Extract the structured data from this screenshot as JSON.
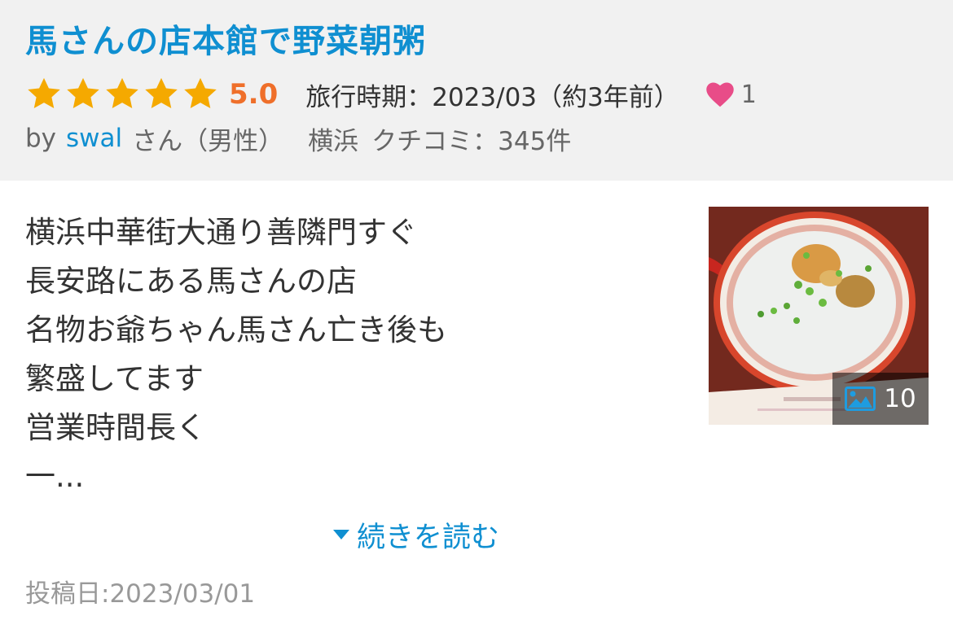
{
  "review": {
    "title": "馬さんの店本館で野菜朝粥",
    "rating": 5,
    "score_text": "5.0",
    "travel_period_label": "旅行時期：",
    "travel_period_value": "2023/03（約3年前）",
    "like_count": "1"
  },
  "author": {
    "by": "by",
    "name": "swal",
    "gender": "さん（男性）",
    "location": "横浜",
    "review_count": "クチコミ：345件"
  },
  "body": {
    "lines": [
      "横浜中華街大通り善隣門すぐ",
      "長安路にある馬さんの店",
      "名物お爺ちゃん馬さん亡き後も",
      "繁盛してます",
      "営業時間長く",
      "一..."
    ]
  },
  "photo": {
    "count": "10",
    "icon": "image-icon"
  },
  "read_more": {
    "label": "続きを読む"
  },
  "posted": {
    "label": "投稿日:2023/03/01"
  },
  "colors": {
    "title": "#0f8fd1",
    "star": "#f5a900",
    "score": "#ef6f2a",
    "heart": "#e84c88",
    "header_bg": "#f1f1f1"
  }
}
